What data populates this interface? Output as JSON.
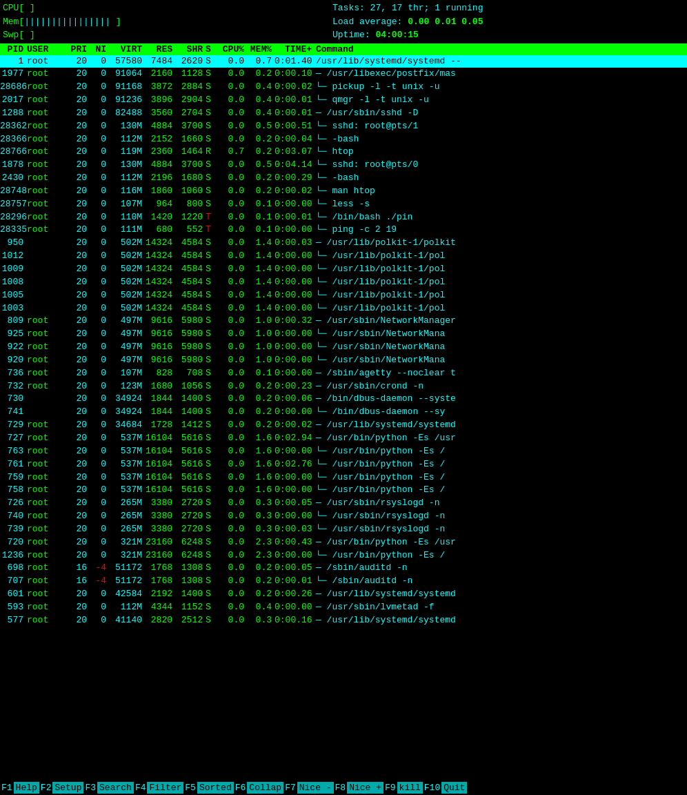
{
  "header": {
    "cpu_label": "CPU[",
    "cpu_bar": "                                                               ]",
    "mem_label": "Mem[",
    "mem_bar": "||||||||||||||||                                               ]",
    "swp_label": "Swp[",
    "swp_bar": "                                                               ]",
    "tasks_label": "Tasks:",
    "tasks_value": "27, 17 thr; 1 running",
    "load_label": "Load average:",
    "load_value": "0.00 0.01 0.05",
    "uptime_label": "Uptime:",
    "uptime_value": "04:00:15"
  },
  "columns": {
    "pid": "PID",
    "user": "USER",
    "pri": "PRI",
    "ni": "NI",
    "virt": "VIRT",
    "res": "RES",
    "shr": "SHR",
    "s": "S",
    "cpu": "CPU%",
    "mem": "MEM%",
    "time": "TIME+",
    "cmd": "Command"
  },
  "processes": [
    {
      "pid": "1",
      "user": "root",
      "pri": "20",
      "ni": "0",
      "virt": "57580",
      "res": "7484",
      "shr": "2620",
      "s": "S",
      "cpu": "0.0",
      "mem": "0.7",
      "time": "0:01.40",
      "cmd": "/usr/lib/systemd/systemd --",
      "highlight": true
    },
    {
      "pid": "1977",
      "user": "root",
      "pri": "20",
      "ni": "0",
      "virt": "91064",
      "res": "2160",
      "shr": "1128",
      "s": "S",
      "cpu": "0.0",
      "mem": "0.2",
      "time": "0:00.10",
      "cmd": "— /usr/libexec/postfix/mas"
    },
    {
      "pid": "28686",
      "user": "root",
      "pri": "20",
      "ni": "0",
      "virt": "91168",
      "res": "3872",
      "shr": "2884",
      "s": "S",
      "cpu": "0.0",
      "mem": "0.4",
      "time": "0:00.02",
      "cmd": "  └─ pickup -l -t unix -u"
    },
    {
      "pid": "2017",
      "user": "root",
      "pri": "20",
      "ni": "0",
      "virt": "91236",
      "res": "3896",
      "shr": "2904",
      "s": "S",
      "cpu": "0.0",
      "mem": "0.4",
      "time": "0:00.01",
      "cmd": "  └─ qmgr -l -t unix -u"
    },
    {
      "pid": "1288",
      "user": "root",
      "pri": "20",
      "ni": "0",
      "virt": "82488",
      "res": "3560",
      "shr": "2704",
      "s": "S",
      "cpu": "0.0",
      "mem": "0.4",
      "time": "0:00.01",
      "cmd": "— /usr/sbin/sshd -D"
    },
    {
      "pid": "28362",
      "user": "root",
      "pri": "20",
      "ni": "0",
      "virt": "130M",
      "res": "4884",
      "shr": "3700",
      "s": "S",
      "cpu": "0.0",
      "mem": "0.5",
      "time": "0:00.51",
      "cmd": "  └─ sshd: root@pts/1"
    },
    {
      "pid": "28366",
      "user": "root",
      "pri": "20",
      "ni": "0",
      "virt": "112M",
      "res": "2152",
      "shr": "1660",
      "s": "S",
      "cpu": "0.0",
      "mem": "0.2",
      "time": "0:00.04",
      "cmd": "    └─ -bash"
    },
    {
      "pid": "28766",
      "user": "root",
      "pri": "20",
      "ni": "0",
      "virt": "119M",
      "res": "2360",
      "shr": "1464",
      "s": "R",
      "cpu": "0.7",
      "mem": "0.2",
      "time": "0:03.07",
      "cmd": "      └─ htop"
    },
    {
      "pid": "1878",
      "user": "root",
      "pri": "20",
      "ni": "0",
      "virt": "130M",
      "res": "4884",
      "shr": "3700",
      "s": "S",
      "cpu": "0.0",
      "mem": "0.5",
      "time": "0:04.14",
      "cmd": "  └─ sshd: root@pts/0"
    },
    {
      "pid": "2430",
      "user": "root",
      "pri": "20",
      "ni": "0",
      "virt": "112M",
      "res": "2196",
      "shr": "1680",
      "s": "S",
      "cpu": "0.0",
      "mem": "0.2",
      "time": "0:00.29",
      "cmd": "    └─ -bash"
    },
    {
      "pid": "28748",
      "user": "root",
      "pri": "20",
      "ni": "0",
      "virt": "116M",
      "res": "1860",
      "shr": "1060",
      "s": "S",
      "cpu": "0.0",
      "mem": "0.2",
      "time": "0:00.02",
      "cmd": "      └─ man htop"
    },
    {
      "pid": "28757",
      "user": "root",
      "pri": "20",
      "ni": "0",
      "virt": "107M",
      "res": "964",
      "shr": "800",
      "s": "S",
      "cpu": "0.0",
      "mem": "0.1",
      "time": "0:00.00",
      "cmd": "        └─ less -s"
    },
    {
      "pid": "28296",
      "user": "root",
      "pri": "20",
      "ni": "0",
      "virt": "110M",
      "res": "1420",
      "shr": "1220",
      "s": "T",
      "cpu": "0.0",
      "mem": "0.1",
      "time": "0:00.01",
      "cmd": "      └─ /bin/bash ./pin"
    },
    {
      "pid": "28335",
      "user": "root",
      "pri": "20",
      "ni": "0",
      "virt": "111M",
      "res": "680",
      "shr": "552",
      "s": "T",
      "cpu": "0.0",
      "mem": "0.1",
      "time": "0:00.00",
      "cmd": "        └─ ping -c 2 19"
    },
    {
      "pid": "950",
      "user": "",
      "pri": "20",
      "ni": "0",
      "virt": "502M",
      "res": "14324",
      "shr": "4584",
      "s": "S",
      "cpu": "0.0",
      "mem": "1.4",
      "time": "0:00.03",
      "cmd": "— /usr/lib/polkit-1/polkit"
    },
    {
      "pid": "1012",
      "user": "",
      "pri": "20",
      "ni": "0",
      "virt": "502M",
      "res": "14324",
      "shr": "4584",
      "s": "S",
      "cpu": "0.0",
      "mem": "1.4",
      "time": "0:00.00",
      "cmd": "  └─ /usr/lib/polkit-1/pol"
    },
    {
      "pid": "1009",
      "user": "",
      "pri": "20",
      "ni": "0",
      "virt": "502M",
      "res": "14324",
      "shr": "4584",
      "s": "S",
      "cpu": "0.0",
      "mem": "1.4",
      "time": "0:00.00",
      "cmd": "  └─ /usr/lib/polkit-1/pol"
    },
    {
      "pid": "1008",
      "user": "",
      "pri": "20",
      "ni": "0",
      "virt": "502M",
      "res": "14324",
      "shr": "4584",
      "s": "S",
      "cpu": "0.0",
      "mem": "1.4",
      "time": "0:00.00",
      "cmd": "  └─ /usr/lib/polkit-1/pol"
    },
    {
      "pid": "1005",
      "user": "",
      "pri": "20",
      "ni": "0",
      "virt": "502M",
      "res": "14324",
      "shr": "4584",
      "s": "S",
      "cpu": "0.0",
      "mem": "1.4",
      "time": "0:00.00",
      "cmd": "  └─ /usr/lib/polkit-1/pol"
    },
    {
      "pid": "1003",
      "user": "",
      "pri": "20",
      "ni": "0",
      "virt": "502M",
      "res": "14324",
      "shr": "4584",
      "s": "S",
      "cpu": "0.0",
      "mem": "1.4",
      "time": "0:00.00",
      "cmd": "  └─ /usr/lib/polkit-1/pol"
    },
    {
      "pid": "809",
      "user": "root",
      "pri": "20",
      "ni": "0",
      "virt": "497M",
      "res": "9616",
      "shr": "5980",
      "s": "S",
      "cpu": "0.0",
      "mem": "1.0",
      "time": "0:00.32",
      "cmd": "— /usr/sbin/NetworkManager"
    },
    {
      "pid": "925",
      "user": "root",
      "pri": "20",
      "ni": "0",
      "virt": "497M",
      "res": "9616",
      "shr": "5980",
      "s": "S",
      "cpu": "0.0",
      "mem": "1.0",
      "time": "0:00.00",
      "cmd": "  └─ /usr/sbin/NetworkMana"
    },
    {
      "pid": "922",
      "user": "root",
      "pri": "20",
      "ni": "0",
      "virt": "497M",
      "res": "9616",
      "shr": "5980",
      "s": "S",
      "cpu": "0.0",
      "mem": "1.0",
      "time": "0:00.00",
      "cmd": "  └─ /usr/sbin/NetworkMana"
    },
    {
      "pid": "920",
      "user": "root",
      "pri": "20",
      "ni": "0",
      "virt": "497M",
      "res": "9616",
      "shr": "5980",
      "s": "S",
      "cpu": "0.0",
      "mem": "1.0",
      "time": "0:00.00",
      "cmd": "  └─ /usr/sbin/NetworkMana"
    },
    {
      "pid": "736",
      "user": "root",
      "pri": "20",
      "ni": "0",
      "virt": "107M",
      "res": "828",
      "shr": "708",
      "s": "S",
      "cpu": "0.0",
      "mem": "0.1",
      "time": "0:00.00",
      "cmd": "— /sbin/agetty --noclear t"
    },
    {
      "pid": "732",
      "user": "root",
      "pri": "20",
      "ni": "0",
      "virt": "123M",
      "res": "1680",
      "shr": "1056",
      "s": "S",
      "cpu": "0.0",
      "mem": "0.2",
      "time": "0:00.23",
      "cmd": "— /usr/sbin/crond -n"
    },
    {
      "pid": "730",
      "user": "",
      "pri": "20",
      "ni": "0",
      "virt": "34924",
      "res": "1844",
      "shr": "1400",
      "s": "S",
      "cpu": "0.0",
      "mem": "0.2",
      "time": "0:00.06",
      "cmd": "— /bin/dbus-daemon --syste"
    },
    {
      "pid": "741",
      "user": "",
      "pri": "20",
      "ni": "0",
      "virt": "34924",
      "res": "1844",
      "shr": "1400",
      "s": "S",
      "cpu": "0.0",
      "mem": "0.2",
      "time": "0:00.00",
      "cmd": "  └─ /bin/dbus-daemon --sy"
    },
    {
      "pid": "729",
      "user": "root",
      "pri": "20",
      "ni": "0",
      "virt": "34684",
      "res": "1728",
      "shr": "1412",
      "s": "S",
      "cpu": "0.0",
      "mem": "0.2",
      "time": "0:00.02",
      "cmd": "— /usr/lib/systemd/systemd"
    },
    {
      "pid": "727",
      "user": "root",
      "pri": "20",
      "ni": "0",
      "virt": "537M",
      "res": "16104",
      "shr": "5616",
      "s": "S",
      "cpu": "0.0",
      "mem": "1.6",
      "time": "0:02.94",
      "cmd": "— /usr/bin/python -Es /usr"
    },
    {
      "pid": "763",
      "user": "root",
      "pri": "20",
      "ni": "0",
      "virt": "537M",
      "res": "16104",
      "shr": "5616",
      "s": "S",
      "cpu": "0.0",
      "mem": "1.6",
      "time": "0:00.00",
      "cmd": "  └─ /usr/bin/python -Es /"
    },
    {
      "pid": "761",
      "user": "root",
      "pri": "20",
      "ni": "0",
      "virt": "537M",
      "res": "16104",
      "shr": "5616",
      "s": "S",
      "cpu": "0.0",
      "mem": "1.6",
      "time": "0:02.76",
      "cmd": "  └─ /usr/bin/python -Es /"
    },
    {
      "pid": "759",
      "user": "root",
      "pri": "20",
      "ni": "0",
      "virt": "537M",
      "res": "16104",
      "shr": "5616",
      "s": "S",
      "cpu": "0.0",
      "mem": "1.6",
      "time": "0:00.00",
      "cmd": "  └─ /usr/bin/python -Es /"
    },
    {
      "pid": "758",
      "user": "root",
      "pri": "20",
      "ni": "0",
      "virt": "537M",
      "res": "16104",
      "shr": "5616",
      "s": "S",
      "cpu": "0.0",
      "mem": "1.6",
      "time": "0:00.00",
      "cmd": "  └─ /usr/bin/python -Es /"
    },
    {
      "pid": "726",
      "user": "root",
      "pri": "20",
      "ni": "0",
      "virt": "265M",
      "res": "3380",
      "shr": "2720",
      "s": "S",
      "cpu": "0.0",
      "mem": "0.3",
      "time": "0:00.05",
      "cmd": "— /usr/sbin/rsyslogd -n"
    },
    {
      "pid": "740",
      "user": "root",
      "pri": "20",
      "ni": "0",
      "virt": "265M",
      "res": "3380",
      "shr": "2720",
      "s": "S",
      "cpu": "0.0",
      "mem": "0.3",
      "time": "0:00.00",
      "cmd": "  └─ /usr/sbin/rsyslogd -n"
    },
    {
      "pid": "739",
      "user": "root",
      "pri": "20",
      "ni": "0",
      "virt": "265M",
      "res": "3380",
      "shr": "2720",
      "s": "S",
      "cpu": "0.0",
      "mem": "0.3",
      "time": "0:00.03",
      "cmd": "  └─ /usr/sbin/rsyslogd -n"
    },
    {
      "pid": "720",
      "user": "root",
      "pri": "20",
      "ni": "0",
      "virt": "321M",
      "res": "23160",
      "shr": "6248",
      "s": "S",
      "cpu": "0.0",
      "mem": "2.3",
      "time": "0:00.43",
      "cmd": "— /usr/bin/python -Es /usr"
    },
    {
      "pid": "1236",
      "user": "root",
      "pri": "20",
      "ni": "0",
      "virt": "321M",
      "res": "23160",
      "shr": "6248",
      "s": "S",
      "cpu": "0.0",
      "mem": "2.3",
      "time": "0:00.00",
      "cmd": "  └─ /usr/bin/python -Es /"
    },
    {
      "pid": "698",
      "user": "root",
      "pri": "16",
      "ni": "-4",
      "virt": "51172",
      "res": "1768",
      "shr": "1308",
      "s": "S",
      "cpu": "0.0",
      "mem": "0.2",
      "time": "0:00.05",
      "cmd": "— /sbin/auditd -n"
    },
    {
      "pid": "707",
      "user": "root",
      "pri": "16",
      "ni": "-4",
      "virt": "51172",
      "res": "1768",
      "shr": "1308",
      "s": "S",
      "cpu": "0.0",
      "mem": "0.2",
      "time": "0:00.01",
      "cmd": "  └─ /sbin/auditd -n"
    },
    {
      "pid": "601",
      "user": "root",
      "pri": "20",
      "ni": "0",
      "virt": "42584",
      "res": "2192",
      "shr": "1400",
      "s": "S",
      "cpu": "0.0",
      "mem": "0.2",
      "time": "0:00.26",
      "cmd": "— /usr/lib/systemd/systemd"
    },
    {
      "pid": "593",
      "user": "root",
      "pri": "20",
      "ni": "0",
      "virt": "112M",
      "res": "4344",
      "shr": "1152",
      "s": "S",
      "cpu": "0.0",
      "mem": "0.4",
      "time": "0:00.00",
      "cmd": "— /usr/sbin/lvmetad -f"
    },
    {
      "pid": "577",
      "user": "root",
      "pri": "20",
      "ni": "0",
      "virt": "41140",
      "res": "2820",
      "shr": "2512",
      "s": "S",
      "cpu": "0.0",
      "mem": "0.3",
      "time": "0:00.16",
      "cmd": "— /usr/lib/systemd/systemd"
    }
  ],
  "footer": {
    "f1": "1",
    "f1_label": "Help",
    "f2": "2",
    "f2_label": "Setup",
    "f3": "3",
    "f3_label": "Search",
    "f4": "4",
    "f4_label": "Filter",
    "f5": "5",
    "f5_label": "Sorted",
    "f6": "6",
    "f6_label": "Collap",
    "f7": "7",
    "f7_label": "Nice -",
    "f8": "8",
    "f8_label": "Nice +",
    "f9": "9",
    "f9_label": "kill",
    "f10": "10",
    "f10_label": "Quit"
  }
}
